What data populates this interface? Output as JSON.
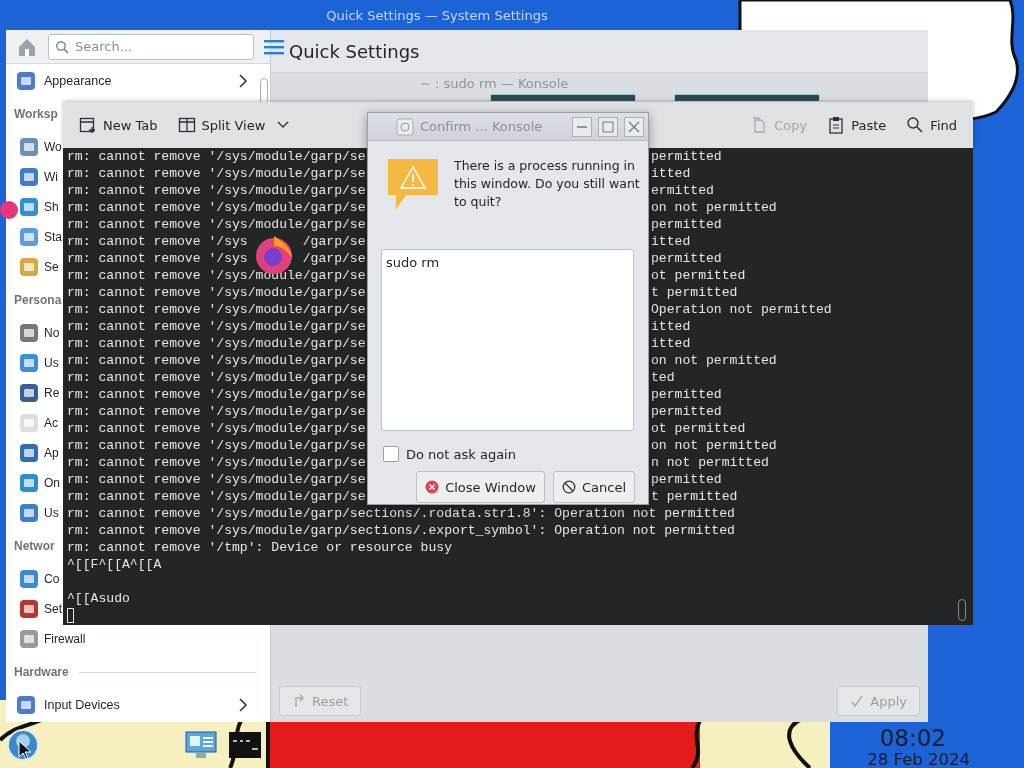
{
  "settings_window": {
    "title": "Quick Settings — System Settings",
    "search": {
      "placeholder": "Search..."
    },
    "page_title": "Quick Settings",
    "sidebar": [
      {
        "kind": "item",
        "label": "Appearance",
        "chevron": true
      },
      {
        "kind": "header",
        "label": "Worksp"
      },
      {
        "kind": "item",
        "label": "Wo",
        "chevron": false
      },
      {
        "kind": "item",
        "label": "Wi",
        "chevron": false
      },
      {
        "kind": "item",
        "label": "Sh",
        "chevron": false
      },
      {
        "kind": "item",
        "label": "Sta",
        "chevron": false
      },
      {
        "kind": "item",
        "label": "Se",
        "chevron": false
      },
      {
        "kind": "header",
        "label": "Persona"
      },
      {
        "kind": "item",
        "label": "No",
        "chevron": false
      },
      {
        "kind": "item",
        "label": "Us",
        "chevron": false
      },
      {
        "kind": "item",
        "label": "Re",
        "chevron": false
      },
      {
        "kind": "item",
        "label": "Ac",
        "chevron": false
      },
      {
        "kind": "item",
        "label": "Ap",
        "chevron": false
      },
      {
        "kind": "item",
        "label": "On",
        "chevron": false
      },
      {
        "kind": "item",
        "label": "Us",
        "chevron": false
      },
      {
        "kind": "header",
        "label": "Networ"
      },
      {
        "kind": "item",
        "label": "Co",
        "chevron": false
      },
      {
        "kind": "item",
        "label": "Set",
        "chevron": false
      },
      {
        "kind": "item",
        "label": "Firewall",
        "chevron": false
      },
      {
        "kind": "header",
        "label": "Hardware"
      },
      {
        "kind": "item",
        "label": "Input Devices",
        "chevron": true
      }
    ],
    "buttons": [
      {
        "kind": "reset",
        "label": "Reset",
        "disabled": true
      },
      {
        "kind": "apply",
        "label": "Apply",
        "disabled": true
      }
    ]
  },
  "konsole": {
    "title": "~ : sudo rm — Konsole",
    "toolbar": [
      {
        "kind": "new-tab",
        "label": "New Tab",
        "disabled": false
      },
      {
        "kind": "split-view",
        "label": "Split View",
        "disabled": false
      },
      {
        "kind": "copy",
        "label": "Copy",
        "disabled": true
      },
      {
        "kind": "paste",
        "label": "Paste",
        "disabled": false
      },
      {
        "kind": "find",
        "label": "Find",
        "disabled": false
      }
    ],
    "lines": [
      {
        "kind": "split",
        "left": "rm: cannot remove '/sys/module/garp/se",
        "right": "permitted"
      },
      {
        "kind": "split",
        "left": "rm: cannot remove '/sys/module/garp/se",
        "right": "itted"
      },
      {
        "kind": "split",
        "left": "rm: cannot remove '/sys/module/garp/se",
        "right": "ermitted"
      },
      {
        "kind": "split",
        "left": "rm: cannot remove '/sys/module/garp/se",
        "right": "on not permitted"
      },
      {
        "kind": "split",
        "left": "rm: cannot remove '/sys/module/garp/se",
        "right": "permitted"
      },
      {
        "kind": "split3",
        "left": "rm: cannot remove '/sys",
        "middle": "/garp/se",
        "right": "itted"
      },
      {
        "kind": "split3",
        "left": "rm: cannot remove '/sys",
        "middle": "/garp/se",
        "right": "permitted"
      },
      {
        "kind": "split",
        "left": "rm: cannot remove '/sys/module/garp/se",
        "right": "ot permitted"
      },
      {
        "kind": "split",
        "left": "rm: cannot remove '/sys/module/garp/se",
        "right": "t permitted"
      },
      {
        "kind": "split",
        "left": "rm: cannot remove '/sys/module/garp/se",
        "right": "Operation not permitted"
      },
      {
        "kind": "split",
        "left": "rm: cannot remove '/sys/module/garp/se",
        "right": "itted"
      },
      {
        "kind": "split",
        "left": "rm: cannot remove '/sys/module/garp/se",
        "right": "itted"
      },
      {
        "kind": "split",
        "left": "rm: cannot remove '/sys/module/garp/se",
        "right": "on not permitted"
      },
      {
        "kind": "split",
        "left": "rm: cannot remove '/sys/module/garp/se",
        "right": "ted"
      },
      {
        "kind": "split",
        "left": "rm: cannot remove '/sys/module/garp/se",
        "right": "permitted"
      },
      {
        "kind": "split",
        "left": "rm: cannot remove '/sys/module/garp/se",
        "right": "permitted"
      },
      {
        "kind": "split",
        "left": "rm: cannot remove '/sys/module/garp/se",
        "right": "ot permitted"
      },
      {
        "kind": "split",
        "left": "rm: cannot remove '/sys/module/garp/se",
        "right": "on not permitted"
      },
      {
        "kind": "split",
        "left": "rm: cannot remove '/sys/module/garp/se",
        "right": "n not permitted"
      },
      {
        "kind": "split",
        "left": "rm: cannot remove '/sys/module/garp/se",
        "right": "permitted"
      },
      {
        "kind": "split",
        "left": "rm: cannot remove '/sys/module/garp/se",
        "right": "t permitted"
      },
      {
        "kind": "full",
        "text": "rm: cannot remove '/sys/module/garp/sections/.rodata.str1.8': Operation not permitted"
      },
      {
        "kind": "full",
        "text": "rm: cannot remove '/sys/module/garp/sections/.export_symbol': Operation not permitted"
      },
      {
        "kind": "full",
        "text": "rm: cannot remove '/tmp': Device or resource busy"
      },
      {
        "kind": "full",
        "text": "^[[F^[[A^[[A"
      },
      {
        "kind": "blank"
      },
      {
        "kind": "full",
        "text": "^[[Asudo"
      },
      {
        "kind": "cursor"
      }
    ]
  },
  "dialog": {
    "title": "Confirm ... Konsole",
    "message": "There is a process running in this window. Do you still want to quit?",
    "details": "sudo rm",
    "checkbox": {
      "label": "Do not ask again",
      "checked": false
    },
    "buttons": [
      {
        "kind": "close",
        "label": "Close Window"
      },
      {
        "kind": "cancel",
        "label": "Cancel"
      }
    ]
  },
  "clock": {
    "time": "08:02",
    "date": "28 Feb 2024"
  }
}
